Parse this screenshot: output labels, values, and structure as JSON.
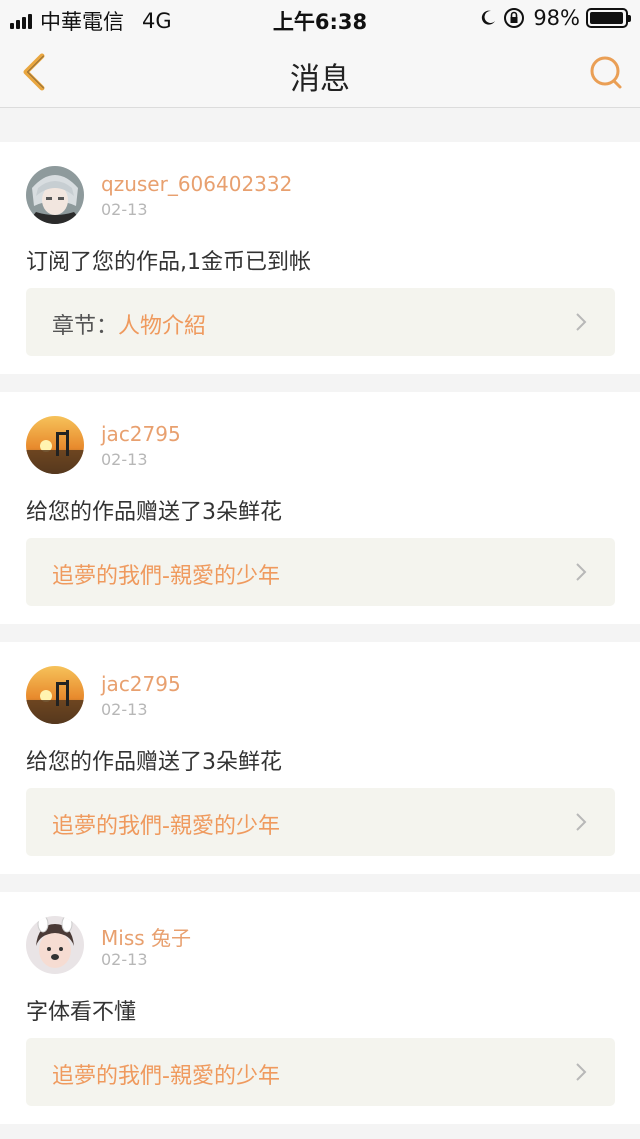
{
  "status_bar": {
    "carrier": "中華電信",
    "network": "4G",
    "time": "上午6:38",
    "battery": "98%",
    "battery_level": 0.98
  },
  "nav": {
    "title": "消息",
    "back_icon": "chevron-left-icon",
    "search_icon": "search-icon",
    "accent_color": "#e9a15a"
  },
  "messages": [
    {
      "user": "qzuser_606402332",
      "date": "02-13",
      "text": "订阅了您的作品,1金币已到帐",
      "link_prefix": "章节：",
      "link_title": "人物介紹",
      "avatar": "anime-character"
    },
    {
      "user": "jac2795",
      "date": "02-13",
      "text": "给您的作品赠送了3朵鲜花",
      "link_prefix": "",
      "link_title": "追夢的我們-親愛的少年",
      "avatar": "sunset"
    },
    {
      "user": "jac2795",
      "date": "02-13",
      "text": "给您的作品赠送了3朵鲜花",
      "link_prefix": "",
      "link_title": "追夢的我們-親愛的少年",
      "avatar": "sunset"
    },
    {
      "user": "Miss 兔子",
      "date": "02-13",
      "text": "字体看不懂",
      "link_prefix": "",
      "link_title": "追夢的我們-親愛的少年",
      "avatar": "girl-bunny"
    }
  ],
  "colors": {
    "username": "#e8a06f",
    "link_title": "#ef9a5e",
    "link_bg": "#f4f4ee",
    "page_bg": "#f4f4f4"
  }
}
